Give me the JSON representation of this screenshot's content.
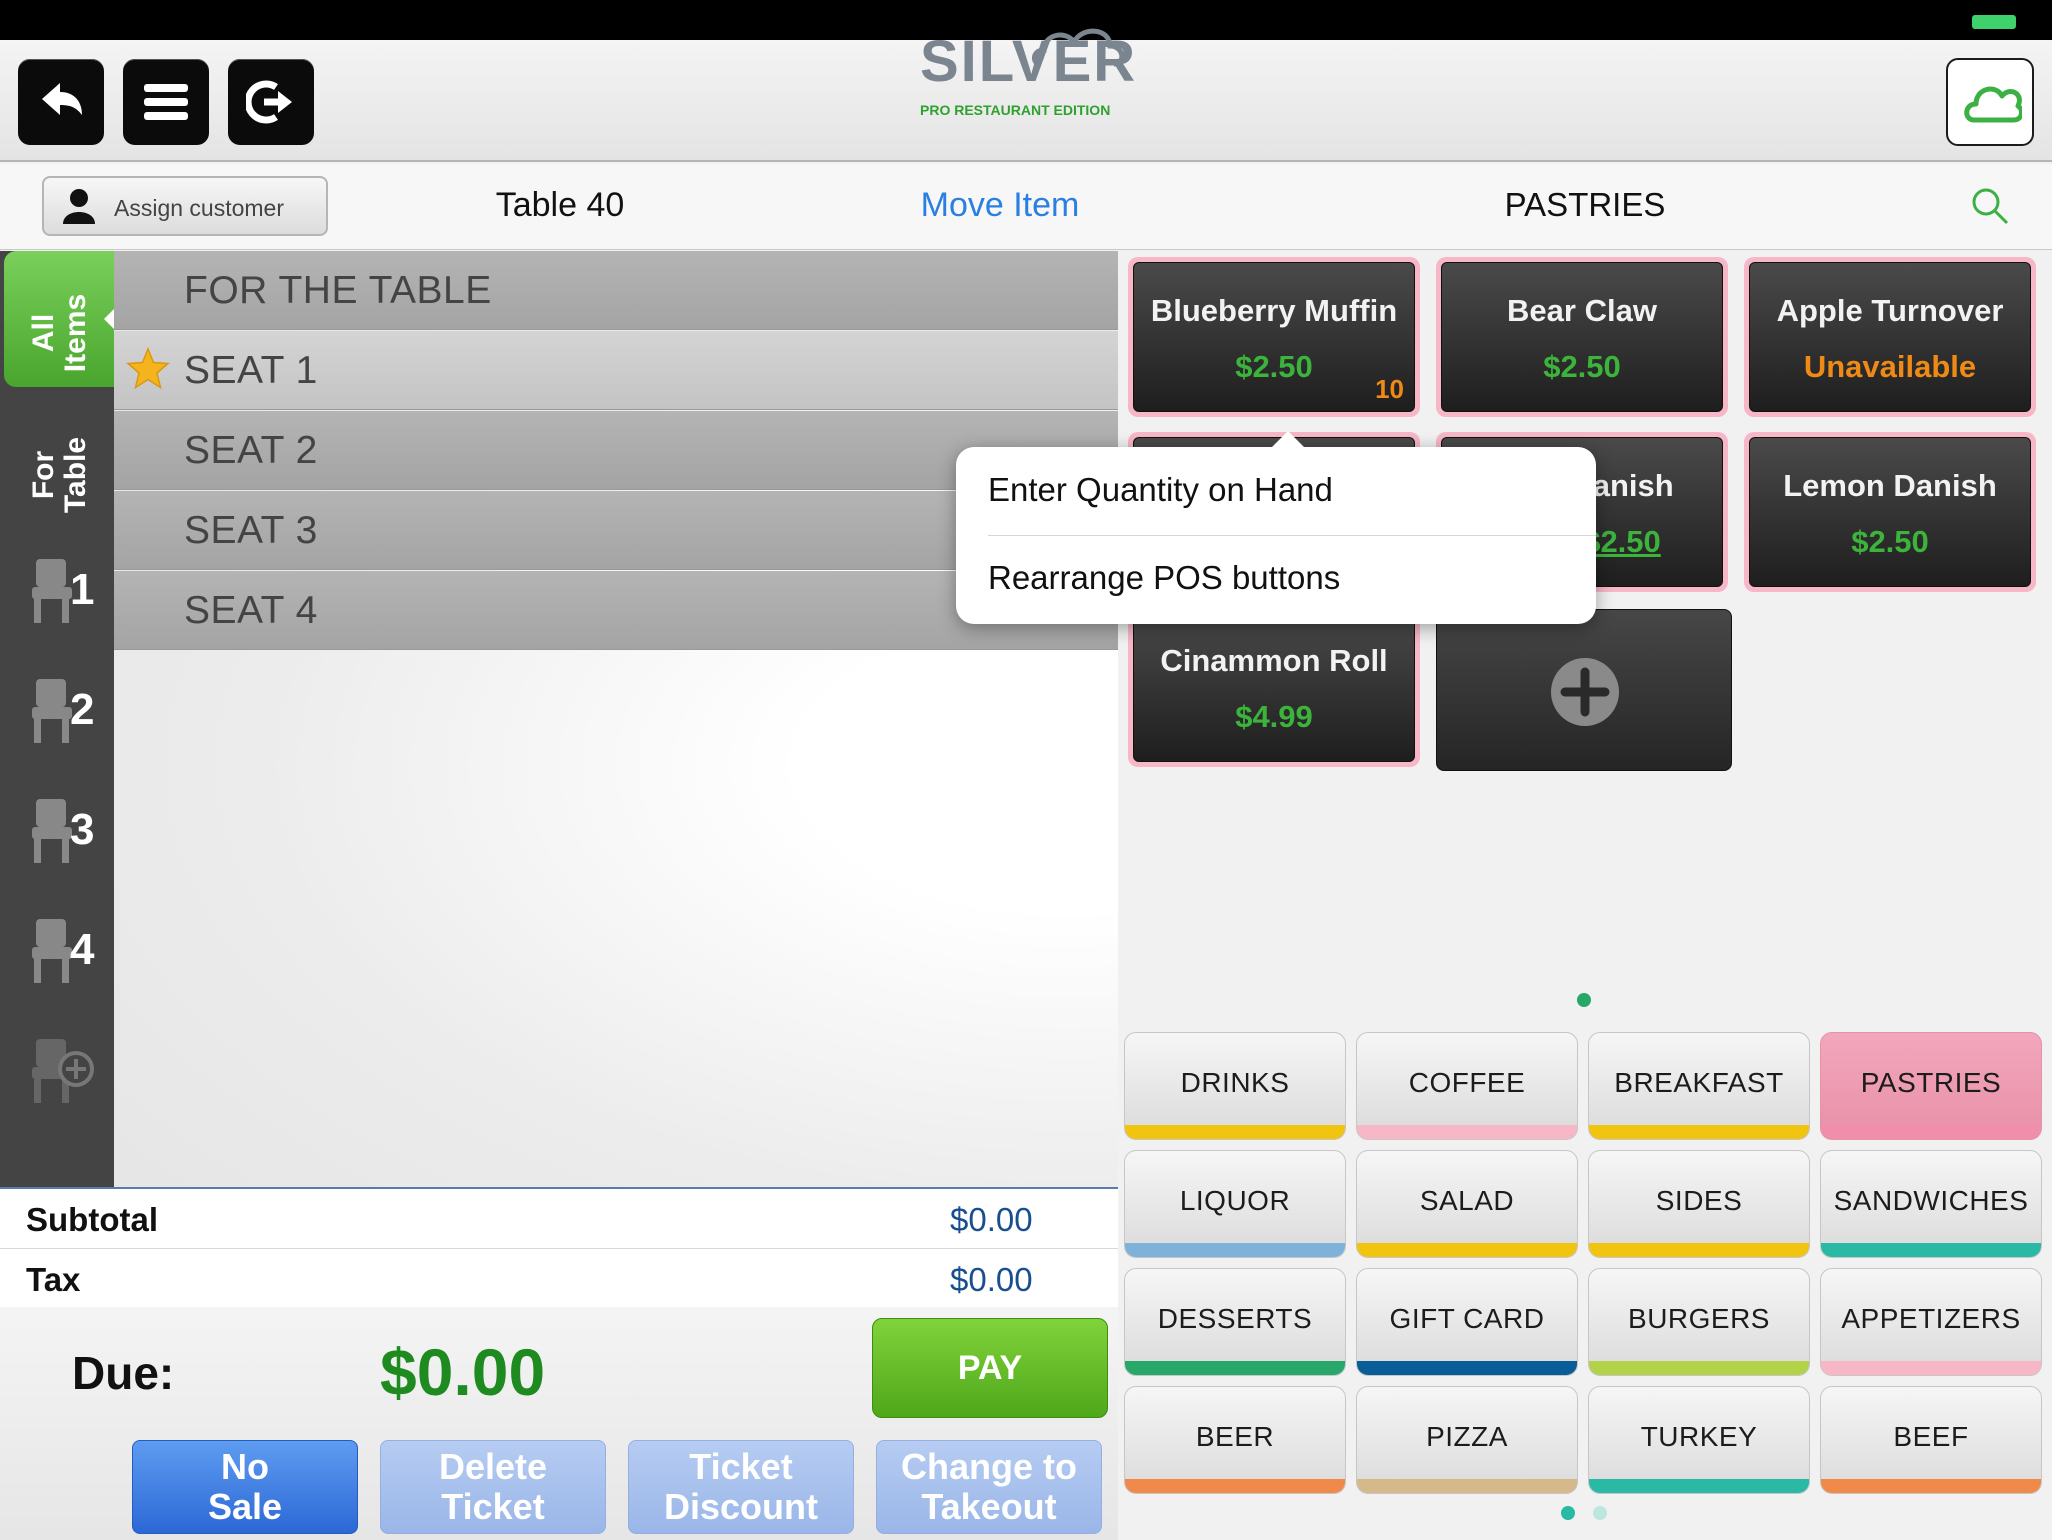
{
  "header": {
    "logo_word": "SILVER",
    "logo_sub": "PRO RESTAURANT EDITION"
  },
  "subheader": {
    "assign_label": "Assign customer",
    "table_title": "Table 40",
    "move_item": "Move Item",
    "category_title": "PASTRIES"
  },
  "rail": {
    "tabs": [
      {
        "label_line1": "All",
        "label_line2": "Items"
      },
      {
        "label_line1": "For",
        "label_line2": "Table"
      }
    ],
    "seats": [
      "1",
      "2",
      "3",
      "4"
    ]
  },
  "seats": {
    "rows": [
      "FOR THE TABLE",
      "SEAT 1",
      "SEAT 2",
      "SEAT 3",
      "SEAT 4"
    ],
    "selected": "SEAT 1"
  },
  "totals": {
    "subtotal_label": "Subtotal",
    "subtotal_value": "$0.00",
    "tax_label": "Tax",
    "tax_value": "$0.00",
    "due_label": "Due:",
    "due_value": "$0.00"
  },
  "actions": {
    "pay": "PAY",
    "buttons": [
      {
        "line1": "No",
        "line2": "Sale",
        "enabled": true
      },
      {
        "line1": "Delete",
        "line2": "Ticket",
        "enabled": false
      },
      {
        "line1": "Ticket",
        "line2": "Discount",
        "enabled": false
      },
      {
        "line1": "Change to",
        "line2": "Takeout",
        "enabled": false
      }
    ]
  },
  "products": [
    {
      "name": "Blueberry Muffin",
      "price": "$2.50",
      "qty": "10"
    },
    {
      "name": "Bear Claw",
      "price": "$2.50"
    },
    {
      "name": "Apple Turnover",
      "price": "Unavailable",
      "unavailable": true
    },
    {
      "name": "",
      "price": ""
    },
    {
      "name": "Danish",
      "price": "$2.50"
    },
    {
      "name": "Lemon Danish",
      "price": "$2.50"
    },
    {
      "name": "Cinammon Roll",
      "price": "$4.99"
    }
  ],
  "popup": {
    "items": [
      "Enter Quantity on Hand",
      "Rearrange POS buttons"
    ]
  },
  "categories": [
    {
      "label": "DRINKS",
      "color": "#f1c40f"
    },
    {
      "label": "COFFEE",
      "color": "#f7b7c7"
    },
    {
      "label": "BREAKFAST",
      "color": "#f1c40f"
    },
    {
      "label": "PASTRIES",
      "color": "#f08fab",
      "active": true
    },
    {
      "label": "LIQUOR",
      "color": "#7fb2d8"
    },
    {
      "label": "SALAD",
      "color": "#f1c40f"
    },
    {
      "label": "SIDES",
      "color": "#f1c40f"
    },
    {
      "label": "SANDWICHES",
      "color": "#29b9a5"
    },
    {
      "label": "DESSERTS",
      "color": "#27a86a"
    },
    {
      "label": "GIFT CARD",
      "color": "#0a5e98"
    },
    {
      "label": "BURGERS",
      "color": "#b2d24a"
    },
    {
      "label": "APPETIZERS",
      "color": "#f7b7c7"
    },
    {
      "label": "BEER",
      "color": "#f08a4b"
    },
    {
      "label": "PIZZA",
      "color": "#d5b98a"
    },
    {
      "label": "TURKEY",
      "color": "#29b9a5"
    },
    {
      "label": "BEEF",
      "color": "#f08a4b"
    }
  ],
  "colors": {
    "accent_green": "#4fa71a",
    "link_blue": "#2a7fe0",
    "due_green": "#1f8a1f"
  }
}
